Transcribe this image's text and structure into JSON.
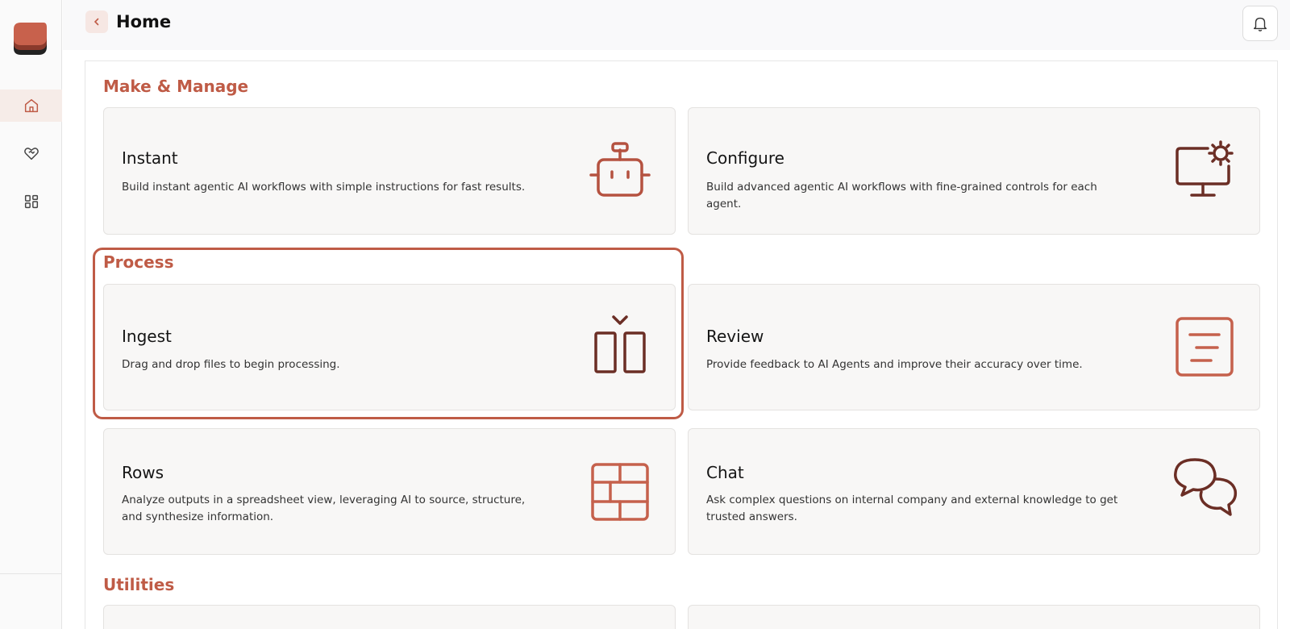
{
  "header": {
    "title": "Home"
  },
  "sections": {
    "make_manage": "Make & Manage",
    "process": "Process",
    "utilities": "Utilities"
  },
  "cards": {
    "instant": {
      "title": "Instant",
      "desc": "Build instant agentic AI workflows with simple instructions for fast results."
    },
    "configure": {
      "title": "Configure",
      "desc": "Build advanced agentic AI workflows with fine-grained controls for each agent."
    },
    "ingest": {
      "title": "Ingest",
      "desc": "Drag and drop files to begin processing."
    },
    "review": {
      "title": "Review",
      "desc": "Provide feedback to AI Agents and improve their accuracy over time."
    },
    "rows": {
      "title": "Rows",
      "desc": "Analyze outputs in a spreadsheet view, leveraging AI to source, structure, and synthesize information."
    },
    "chat": {
      "title": "Chat",
      "desc": "Ask complex questions on internal company and external knowledge to get trusted answers."
    }
  },
  "icons": {
    "logo": "layered-logo-icon",
    "home": "home-icon",
    "heart": "heart-handshake-icon",
    "apps": "grid-icon",
    "back": "chevron-left-icon",
    "bell": "bell-icon",
    "instant": "robot-icon",
    "configure": "monitor-gear-icon",
    "ingest": "upload-columns-icon",
    "review": "document-lines-icon",
    "rows": "table-icon",
    "chat": "chat-bubbles-icon"
  },
  "colors": {
    "accent": "#bf5b46",
    "icon_dark": "#6b2e25",
    "card_bg": "#f8f7f6"
  }
}
